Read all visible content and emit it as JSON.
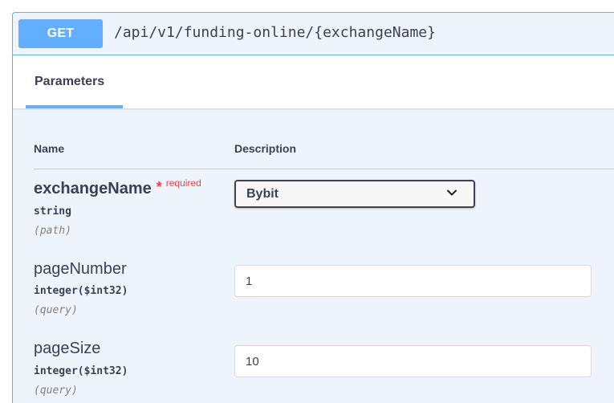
{
  "operation": {
    "method": "GET",
    "path": "/api/v1/funding-online/{exchangeName}"
  },
  "tabs": [
    {
      "label": "Parameters",
      "active": true
    }
  ],
  "table": {
    "name_header": "Name",
    "description_header": "Description"
  },
  "params": [
    {
      "name": "exchangeName",
      "required_mark": "*",
      "required_label": "required",
      "type": "string",
      "in": "(path)",
      "control": "select",
      "value": "Bybit"
    },
    {
      "name": "pageNumber",
      "type": "integer($int32)",
      "in": "(query)",
      "control": "input",
      "value": "1"
    },
    {
      "name": "pageSize",
      "type": "integer($int32)",
      "in": "(query)",
      "control": "input",
      "value": "10"
    }
  ],
  "colors": {
    "get_accent": "#61affe",
    "opblock_background": "#eef4fb",
    "required": "#f93e3e",
    "text": "#3b4151"
  },
  "icons": {
    "select_arrow": "chevron-down-icon"
  }
}
